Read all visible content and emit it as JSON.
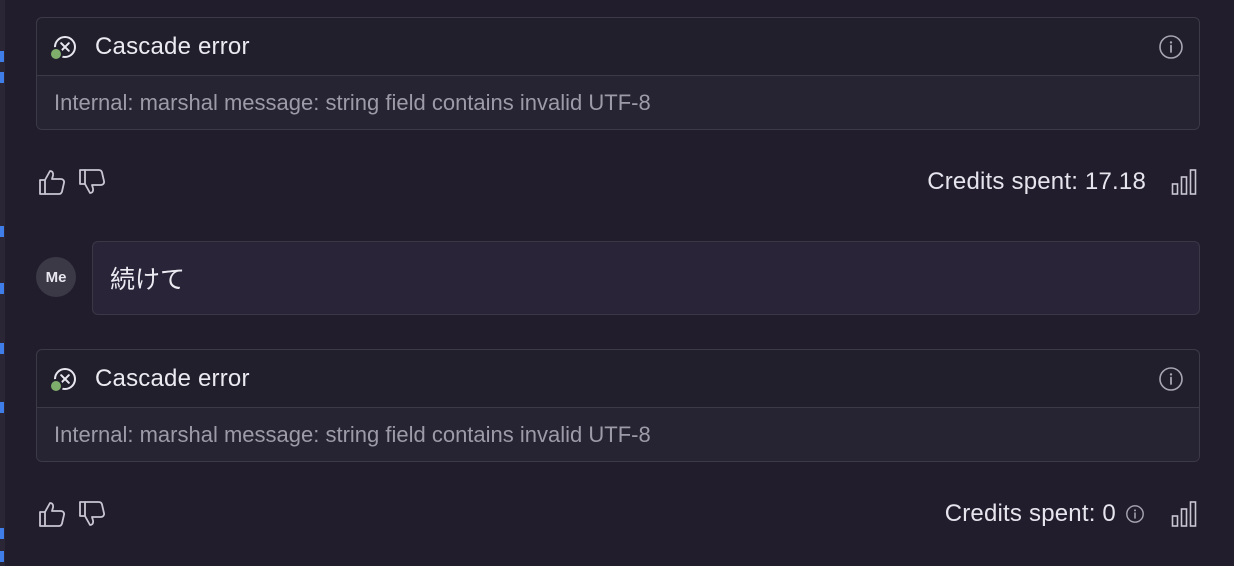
{
  "colors": {
    "background": "#211d2d",
    "card_border": "#3d3a48",
    "status_dot": "#7fae6c",
    "gutter_marker": "#3f7ee8",
    "bubble_bg": "#2a2439"
  },
  "messages": [
    {
      "type": "error",
      "title": "Cascade error",
      "detail": "Internal: marshal message: string field contains invalid UTF-8",
      "icons": [
        "error-circle-x-icon",
        "info-icon"
      ]
    },
    {
      "type": "feedback",
      "credits_text": "Credits spent: 17.18",
      "icons": [
        "thumbs-up-icon",
        "thumbs-down-icon",
        "bar-chart-icon"
      ]
    },
    {
      "type": "user",
      "avatar_label": "Me",
      "text": "続けて"
    },
    {
      "type": "error",
      "title": "Cascade error",
      "detail": "Internal: marshal message: string field contains invalid UTF-8",
      "icons": [
        "error-circle-x-icon",
        "info-icon"
      ]
    },
    {
      "type": "feedback",
      "credits_text": "Credits spent: 0",
      "icons": [
        "thumbs-up-icon",
        "thumbs-down-icon",
        "info-icon",
        "bar-chart-icon"
      ]
    }
  ]
}
